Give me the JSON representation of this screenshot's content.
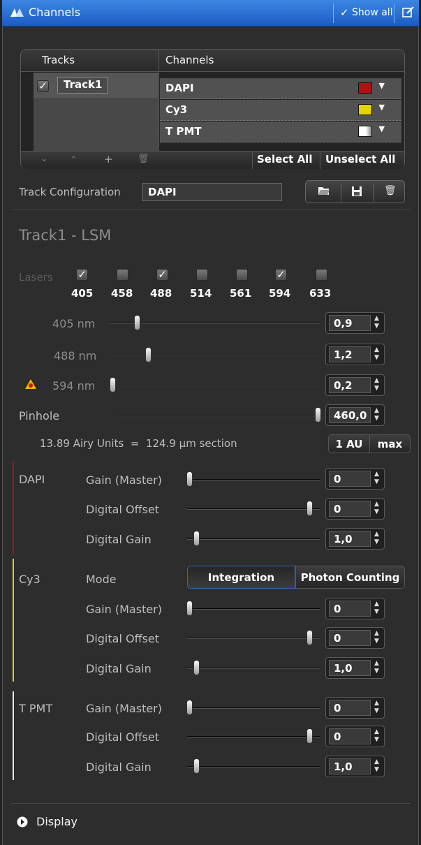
{
  "colors": {
    "dapi": "#b01212",
    "cy3": "#e2d400",
    "tpmt": "#ffffff",
    "accent": "#1e5fc6"
  },
  "title_bar": {
    "title": "Channels",
    "show_all": "Show all",
    "icons": [
      "channels-icon",
      "checkmark-icon",
      "edit-icon"
    ]
  },
  "tracks_table": {
    "col_tracks": "Tracks",
    "col_channels": "Channels",
    "track_name": "Track1",
    "channels": [
      {
        "name": "DAPI",
        "swatch": "#b01212"
      },
      {
        "name": "Cy3",
        "swatch": "#e2d400"
      },
      {
        "name": "T PMT",
        "swatch": "#ffffff"
      }
    ],
    "select_all": "Select All",
    "unselect_all": "Unselect All",
    "toolbar_icons": [
      "move-down-icon",
      "move-up-icon",
      "add-icon",
      "delete-icon"
    ]
  },
  "track_config": {
    "label": "Track Configuration",
    "value": "DAPI",
    "icons": [
      "open-folder-icon",
      "save-icon",
      "delete-icon"
    ]
  },
  "track_header": "Track1 - LSM",
  "lasers": {
    "label": "Lasers",
    "items": [
      {
        "wl": "405",
        "on": true
      },
      {
        "wl": "458",
        "on": false
      },
      {
        "wl": "488",
        "on": true
      },
      {
        "wl": "514",
        "on": false
      },
      {
        "wl": "561",
        "on": false
      },
      {
        "wl": "594",
        "on": true
      },
      {
        "wl": "633",
        "on": false
      }
    ],
    "sliders": [
      {
        "label": "405 nm",
        "value": "0,9"
      },
      {
        "label": "488 nm",
        "value": "1,2"
      },
      {
        "label": "594 nm",
        "value": "0,2"
      }
    ]
  },
  "pinhole": {
    "label": "Pinhole",
    "value": "460,0",
    "info": "13.89 Airy Units  =  124.9 µm section",
    "btn_1au": "1 AU",
    "btn_max": "max"
  },
  "dapi": {
    "name": "DAPI",
    "gain_label": "Gain (Master)",
    "gain": "0",
    "offset_label": "Digital Offset",
    "offset": "0",
    "dgain_label": "Digital Gain",
    "dgain": "1,0"
  },
  "cy3": {
    "name": "Cy3",
    "mode_label": "Mode",
    "mode_integration": "Integration",
    "mode_photon": "Photon Counting",
    "gain_label": "Gain (Master)",
    "gain": "0",
    "offset_label": "Digital Offset",
    "offset": "0",
    "dgain_label": "Digital Gain",
    "dgain": "1,0"
  },
  "tpmt": {
    "name": "T PMT",
    "gain_label": "Gain (Master)",
    "gain": "0",
    "offset_label": "Digital Offset",
    "offset": "0",
    "dgain_label": "Digital Gain",
    "dgain": "1,0"
  },
  "footer": {
    "display": "Display"
  }
}
